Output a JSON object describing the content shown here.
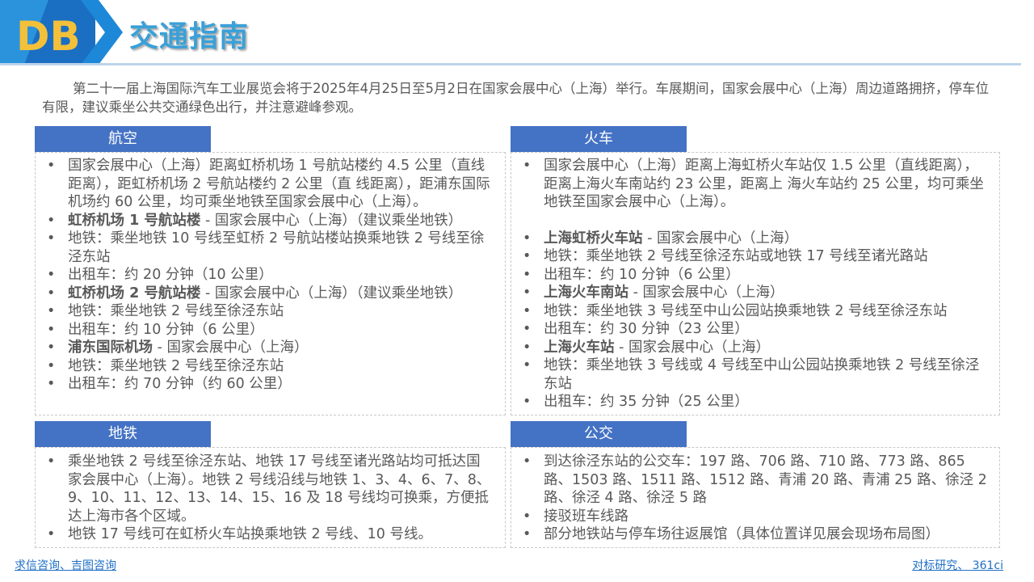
{
  "header": {
    "logo_text": "DB",
    "title": "交通指南",
    "accent": "#3aa0d8",
    "logo_bg": "#1565b8"
  },
  "intro": "第二十一届上海国际汽车工业展览会将于2025年4月25日至5月2日在国家会展中心（上海）举行。车展期间，国家会展中心（上海）周边道路拥挤，停车位有限，建议乘坐公共交通绿色出行，并注意避峰参观。",
  "sections": {
    "air": {
      "tab": "航空",
      "items": [
        {
          "text": "国家会展中心（上海）距离虹桥机场 1 号航站楼约 4.5 公里（直线距离），距虹桥机场 2 号航站楼约 2 公里（直 线距离），距浦东国际机场约 60 公里，均可乘坐地铁至国家会展中心（上海）。"
        },
        {
          "bold": "虹桥机场 1 号航站楼",
          "rest": " - 国家会展中心（上海）（建议乘坐地铁）"
        },
        {
          "text": "地铁：乘坐地铁 10 号线至虹桥 2 号航站楼站换乘地铁 2 号线至徐泾东站"
        },
        {
          "text": "出租车：约 20 分钟（10 公里）"
        },
        {
          "bold": "虹桥机场 2 号航站楼",
          "rest": " - 国家会展中心（上海）（建议乘坐地铁）"
        },
        {
          "text": "地铁：乘坐地铁 2 号线至徐泾东站"
        },
        {
          "text": "出租车：约 10 分钟（6 公里）"
        },
        {
          "bold": "浦东国际机场",
          "rest": " - 国家会展中心（上海）"
        },
        {
          "text": "地铁：乘坐地铁 2 号线至徐泾东站"
        },
        {
          "text": "出租车：约 70 分钟（约 60 公里）"
        }
      ]
    },
    "train": {
      "tab": "火车",
      "items": [
        {
          "text": "国家会展中心（上海）距离上海虹桥火车站仅 1.5 公里（直线距离），距离上海火车南站约 23 公里，距离上 海火车站约 25 公里，均可乘坐地铁至国家会展中心（上海）。"
        },
        {
          "bold": "上海虹桥火车站",
          "rest": " - 国家会展中心（上海）"
        },
        {
          "text": "地铁：乘坐地铁 2 号线至徐泾东站或地铁 17 号线至诸光路站"
        },
        {
          "text": "出租车：约 10 分钟（6 公里）"
        },
        {
          "bold": "上海火车南站",
          "rest": " - 国家会展中心（上海）"
        },
        {
          "text": "地铁：乘坐地铁 3 号线至中山公园站换乘地铁 2 号线至徐泾东站"
        },
        {
          "text": "出租车：约 30 分钟（23 公里）"
        },
        {
          "bold": "上海火车站",
          "rest": " - 国家会展中心（上海）"
        },
        {
          "text": "地铁：乘坐地铁 3 号线或 4 号线至中山公园站换乘地铁 2 号线至徐泾东站"
        },
        {
          "text": "出租车：约 35 分钟（25 公里）"
        }
      ]
    },
    "metro": {
      "tab": "地铁",
      "items": [
        {
          "text": "乘坐地铁 2 号线至徐泾东站、地铁 17 号线至诸光路站均可抵达国家会展中心（上海）。地铁 2 号线沿线与地铁 1、3、4、6、7、8、9、10、11、12、13、14、15、16 及 18 号线均可换乘，方便抵达上海市各个区域。"
        },
        {
          "text": "地铁 17 号线可在虹桥火车站换乘地铁 2 号线、10 号线。"
        }
      ]
    },
    "bus": {
      "tab": "公交",
      "items": [
        {
          "text": "到达徐泾东站的公交车：197 路、706 路、710 路、773 路、865 路、1503 路、1511 路、1512 路、青浦 20 路、青浦 25 路、徐泾 2 路、徐泾 4 路、徐泾 5 路"
        },
        {
          "text": "接驳班车线路"
        },
        {
          "text": "部分地铁站与停车场往返展馆（具体位置详见展会现场布局图）"
        }
      ]
    }
  },
  "footer": {
    "left": "求信咨询、吉图咨询",
    "right": "对标研究、 361ci"
  },
  "colors": {
    "tab_bg": "#4472c4",
    "link": "#1f6fc6"
  }
}
